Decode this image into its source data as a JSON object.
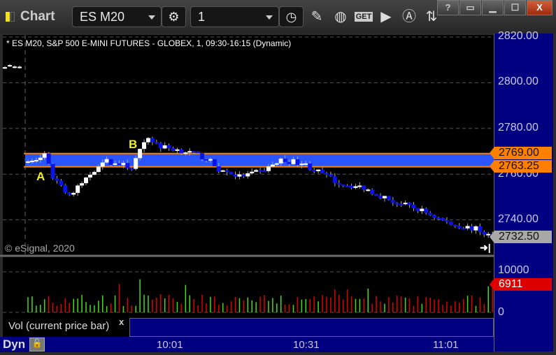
{
  "window": {
    "title": "Chart",
    "buttons": [
      "?",
      "restore",
      "minimize",
      "maximize",
      "X"
    ]
  },
  "toolbar": {
    "symbol": "ES M20",
    "interval": "1",
    "icons": [
      "gear-icon",
      "clock-icon",
      "pencil-icon",
      "chart-line-icon",
      "get-icon",
      "play-icon",
      "a-circle-icon",
      "arrows-icon"
    ],
    "get_label": "GET"
  },
  "chart": {
    "header": "* ES M20, S&P 500 E-MINI FUTURES - GLOBEX, 1, 09:30-16:15 (Dynamic)",
    "copyright": "© eSignal, 2020",
    "price_ticks": [
      "2820.00",
      "2800.00",
      "2780.00",
      "2760.00",
      "2740.00"
    ],
    "price_tick_values": [
      2820,
      2800,
      2780,
      2760,
      2740
    ],
    "zone": {
      "high": 2769.0,
      "low": 2763.25,
      "high_label": "2769.00",
      "low_label": "2763.25",
      "color": "#2a55ff",
      "edge_color": "#ff8000"
    },
    "last_price": "2732.50",
    "markers": {
      "a": "A",
      "b": "B"
    },
    "premarket_level": 2807,
    "session_start": "09:30",
    "price_path": [
      [
        "09:30",
        2765
      ],
      [
        "09:34",
        2768
      ],
      [
        "09:36",
        2759
      ],
      [
        "09:40",
        2751
      ],
      [
        "09:41",
        2752
      ],
      [
        "09:46",
        2762
      ],
      [
        "09:48",
        2766
      ],
      [
        "09:55",
        2763
      ],
      [
        "09:57",
        2770
      ],
      [
        "09:59",
        2776
      ],
      [
        "10:02",
        2772
      ],
      [
        "10:08",
        2770
      ],
      [
        "10:13",
        2767
      ],
      [
        "10:16",
        2762
      ],
      [
        "10:21",
        2759
      ],
      [
        "10:26",
        2761
      ],
      [
        "10:31",
        2766
      ],
      [
        "10:36",
        2765
      ],
      [
        "10:40",
        2761
      ],
      [
        "10:45",
        2756
      ],
      [
        "10:51",
        2754
      ],
      [
        "10:58",
        2748
      ],
      [
        "11:05",
        2744
      ],
      [
        "11:12",
        2738
      ],
      [
        "11:18",
        2736
      ],
      [
        "11:22",
        2732.5
      ]
    ],
    "colors": {
      "up": "#ffffff",
      "down": "#0a14e6",
      "vol_up": "#44dd11",
      "vol_down": "#e00000"
    }
  },
  "volume": {
    "label": "Vol (current price bar)",
    "close": "x",
    "ticks": [
      "10000",
      "0"
    ],
    "current": "6911"
  },
  "time_axis": [
    "10:01",
    "10:31",
    "11:01"
  ],
  "footer": {
    "mode": "Dyn"
  }
}
